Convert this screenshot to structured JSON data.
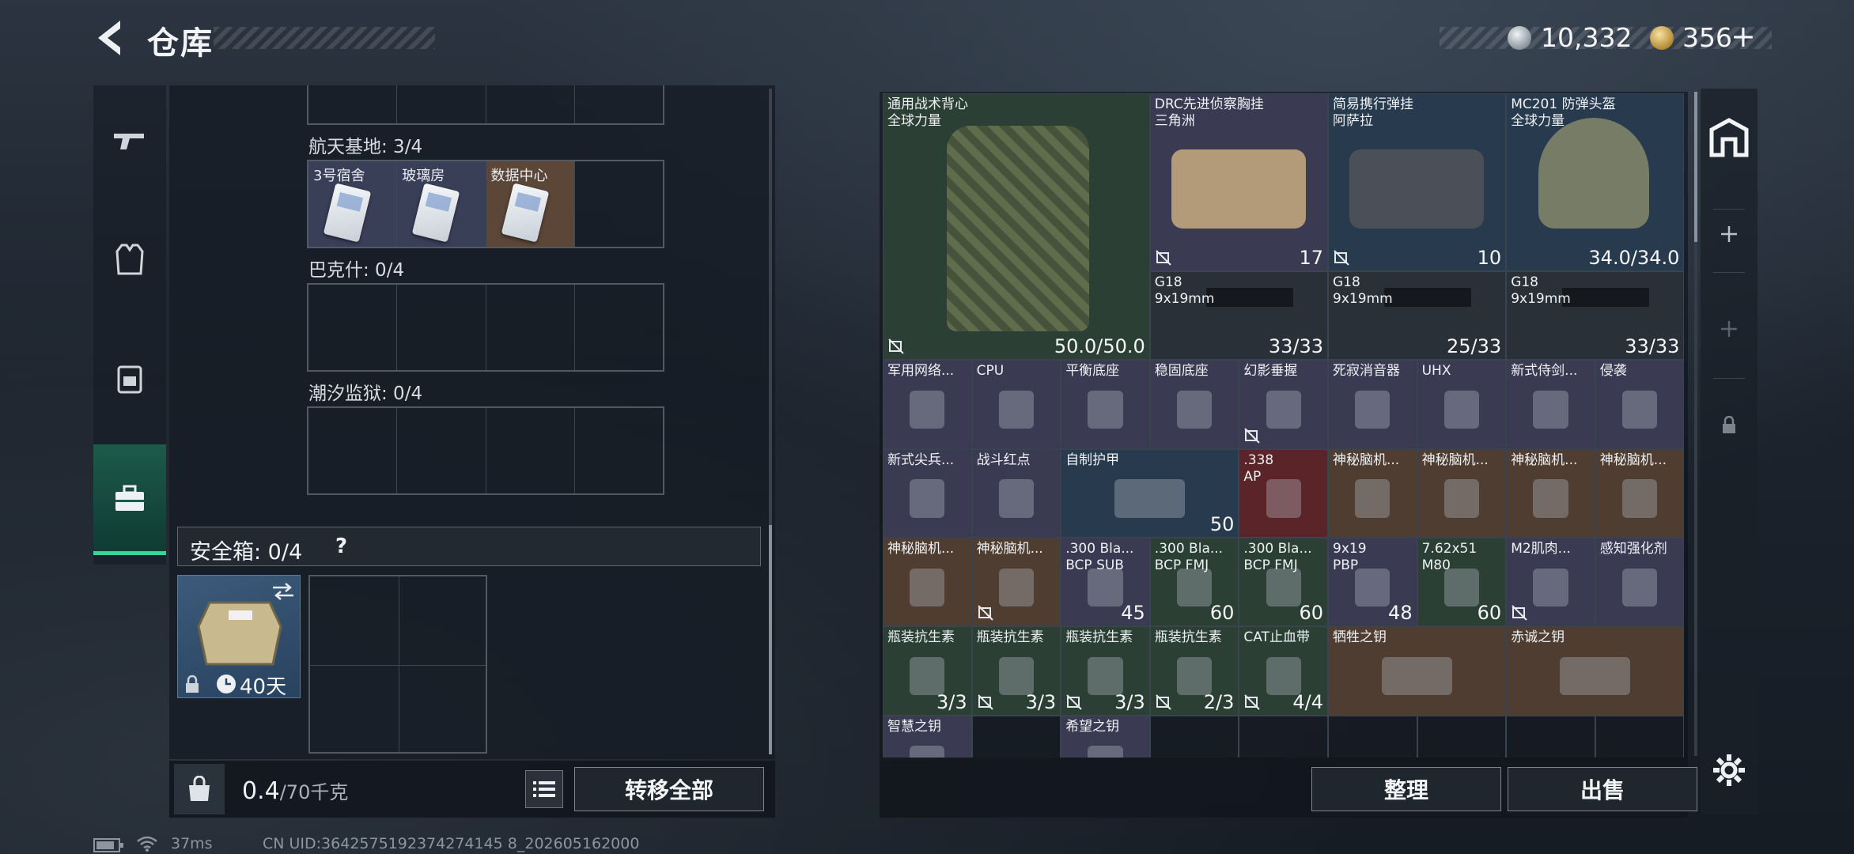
{
  "header": {
    "title": "仓库",
    "currency1": "10,332",
    "currency2": "356",
    "add": "+"
  },
  "left_tabs": [
    {
      "name": "weapons-tab",
      "icon": "gun-icon"
    },
    {
      "name": "armor-tab",
      "icon": "vest-icon"
    },
    {
      "name": "backpack-tab",
      "icon": "backpack-icon"
    },
    {
      "name": "keys-tab",
      "icon": "briefcase-icon",
      "active": true
    }
  ],
  "key_sections": [
    {
      "label": "航天基地: 3/4",
      "cells": [
        "3号宿舍",
        "玻璃房",
        "数据中心"
      ]
    },
    {
      "label": "巴克什: 0/4"
    },
    {
      "label": "潮汐监狱: 0/4"
    }
  ],
  "safe": {
    "label": "安全箱: 0/4",
    "help": "?",
    "days": "40天"
  },
  "footer_left": {
    "weight": "0.4",
    "weight_max": "/70千克",
    "transfer_all": "转移全部"
  },
  "footer_right": {
    "sort": "整理",
    "sell": "出售"
  },
  "inventory": [
    {
      "name": "通用战术背心\n全球力量",
      "value": "50.0/50.0",
      "color": "green"
    },
    {
      "name": "DRC先进侦察胸挂\n三角洲",
      "value": "17",
      "color": "purple"
    },
    {
      "name": "简易携行弹挂\n阿萨拉",
      "value": "10",
      "color": "blue"
    },
    {
      "name": "MC201 防弹头盔\n全球力量",
      "value": "34.0/34.0",
      "color": "blue"
    },
    {
      "name": "G18\n9x19mm",
      "value": "33/33",
      "color": "gray"
    },
    {
      "name": "G18\n9x19mm",
      "value": "25/33",
      "color": "gray"
    },
    {
      "name": "G18\n9x19mm",
      "value": "33/33",
      "color": "gray"
    },
    {
      "name": "军用网络...",
      "color": "purple"
    },
    {
      "name": "CPU",
      "color": "purple"
    },
    {
      "name": "平衡底座",
      "color": "purple"
    },
    {
      "name": "稳固底座",
      "color": "purple"
    },
    {
      "name": "幻影垂握",
      "color": "purple"
    },
    {
      "name": "死寂消音器",
      "color": "purple"
    },
    {
      "name": "UHX",
      "color": "purple"
    },
    {
      "name": "新式侍剑...",
      "color": "purple"
    },
    {
      "name": "侵袭",
      "color": "purple"
    },
    {
      "name": "新式尖兵...",
      "color": "purple"
    },
    {
      "name": "战斗红点",
      "color": "purple"
    },
    {
      "name": "自制护甲",
      "value": "50",
      "color": "blue"
    },
    {
      "name": ".338\nAP",
      "color": "red"
    },
    {
      "name": "神秘脑机...",
      "color": "brown"
    },
    {
      "name": "神秘脑机...",
      "color": "brown"
    },
    {
      "name": "神秘脑机...",
      "color": "brown"
    },
    {
      "name": "神秘脑机...",
      "color": "brown"
    },
    {
      "name": "神秘脑机...",
      "color": "brown"
    },
    {
      "name": "神秘脑机...",
      "color": "brown"
    },
    {
      "name": ".300 Bla...\nBCP SUB",
      "value": "45",
      "color": "purple"
    },
    {
      "name": ".300 Bla...\nBCP FMJ",
      "value": "60",
      "color": "green"
    },
    {
      "name": ".300 Bla...\nBCP FMJ",
      "value": "60",
      "color": "green"
    },
    {
      "name": "9x19\nPBP",
      "value": "48",
      "color": "purple"
    },
    {
      "name": "7.62x51\nM80",
      "value": "60",
      "color": "green"
    },
    {
      "name": "M2肌肉...",
      "color": "purple"
    },
    {
      "name": "感知强化剂",
      "color": "purple"
    },
    {
      "name": "瓶装抗生素",
      "value": "3/3",
      "color": "green"
    },
    {
      "name": "瓶装抗生素",
      "value": "3/3",
      "color": "green"
    },
    {
      "name": "瓶装抗生素",
      "value": "3/3",
      "color": "green"
    },
    {
      "name": "瓶装抗生素",
      "value": "2/3",
      "color": "green"
    },
    {
      "name": "CAT止血带",
      "value": "4/4",
      "color": "green"
    },
    {
      "name": "牺牲之钥",
      "color": "brown"
    },
    {
      "name": "赤诚之钥",
      "color": "brown"
    },
    {
      "name": "智慧之钥",
      "color": "purple"
    },
    {
      "name": "希望之钥",
      "color": "purple"
    }
  ],
  "status_bar": {
    "ping": "37ms",
    "uid": "CN UID:3642575192374274145 8_202605162000"
  },
  "colors": {
    "accent": "#37d49a",
    "green": "#2b3f35",
    "purple": "#3a3b52",
    "brown": "#4f3d31"
  }
}
